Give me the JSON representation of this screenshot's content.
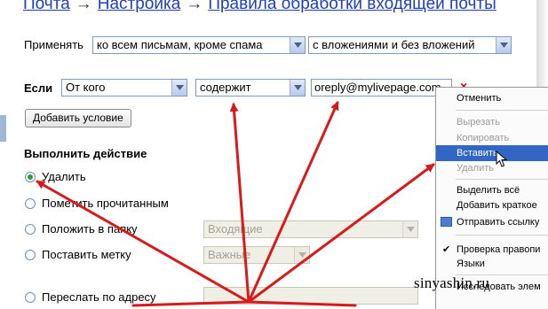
{
  "breadcrumb": {
    "items": [
      "Почта",
      "Настройка",
      "Правила обработки входящей почты"
    ],
    "separator": "→"
  },
  "apply": {
    "label": "Применять",
    "scope_value": "ко всем письмам, кроме спама",
    "attach_value": "с вложениями и без вложений"
  },
  "condition": {
    "label": "Если",
    "field_value": "От кого",
    "operator_value": "содержит",
    "text_value": "oreply@mylivepage.com",
    "remove_symbol": "×",
    "add_button_label": "Добавить условие"
  },
  "action": {
    "heading": "Выполнить действие",
    "options": [
      {
        "label": "Удалить",
        "selected": true
      },
      {
        "label": "Пометить прочитанным",
        "selected": false
      },
      {
        "label": "Положить в папку",
        "selected": false,
        "control_value": "Входящие"
      },
      {
        "label": "Поставить метку",
        "selected": false,
        "control_value": "Важные"
      },
      {
        "label": "Переслать по адресу",
        "selected": false
      }
    ]
  },
  "context_menu": {
    "items": [
      {
        "label": "Отменить",
        "state": "enabled"
      },
      {
        "label": "Вырезать",
        "state": "disabled"
      },
      {
        "label": "Копировать",
        "state": "disabled"
      },
      {
        "label": "Вставить",
        "state": "highlighted"
      },
      {
        "label": "Удалить",
        "state": "disabled"
      },
      {
        "label": "Выделить всё",
        "state": "enabled"
      },
      {
        "label": "Добавить краткое",
        "state": "enabled"
      },
      {
        "label": "Отправить ссылку",
        "state": "enabled",
        "icon": "envelope-icon"
      },
      {
        "label": "Проверка правопи",
        "state": "enabled",
        "checked": true
      },
      {
        "label": "Языки",
        "state": "enabled"
      },
      {
        "label": "Исследовать элем",
        "state": "enabled"
      }
    ]
  },
  "watermark": "sinyashin.ru",
  "colors": {
    "link": "#1f3fbf",
    "arrow": "#d91a1a",
    "menu_highlight": "#3166c4",
    "radio_selected": "#2e9c2e"
  }
}
